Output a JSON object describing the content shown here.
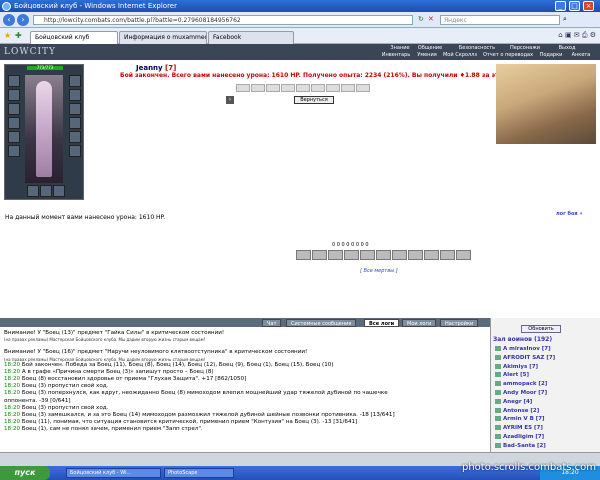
{
  "window": {
    "title": "Бойцовский клуб - Windows Internet Explorer"
  },
  "browser": {
    "address": "http://lowcity.combats.com/battle.pl?battle=0.279608184956762",
    "search_placeholder": "Яндекс",
    "tabs": [
      {
        "label": "Бойцовский клуб"
      },
      {
        "label": "Информация о muxammed"
      },
      {
        "label": "Facebook"
      }
    ]
  },
  "game_nav": {
    "logo": "LOWCITY",
    "row1": [
      "Знание",
      "Общение",
      "Безопасность",
      "Персонажи",
      "Выход"
    ],
    "row2": [
      "Инвентарь",
      "Умения",
      "Мой Скроллз",
      "Отчет о переводах",
      "Подарки",
      "Анкета"
    ]
  },
  "character": {
    "name": "Jeanny",
    "level": "[7]",
    "hp": "773/773"
  },
  "combat": {
    "result": "Бой закончен. Всего вами нанесено урона: 1610 HP. Получено опыта: 2234 (216%). Вы получили ♦1.88 за этот бой.",
    "return_label": "Вернуться",
    "counters": "0 0 0 0 0 0 0 0",
    "all_dead": "[ Все мертвы ]",
    "battle_log": "лог боя »",
    "damage_text": "На данный момент вами нанесено урона: 1610 HP."
  },
  "chat": {
    "tabs": [
      "Чат",
      "Системные сообщения",
      "Все логи",
      "Мои логи",
      "Настройки"
    ],
    "active_tab": "Все логи",
    "lines": [
      {
        "text": "Внимание! У \"Боец (13)\" предмет \"Гайка Силы\" в критическом состоянии!"
      },
      {
        "text": "(на правах рекламы) Мастерская Бойцовского клуба. Мы дадим вторую жизнь старым вещам!",
        "small": true
      },
      {
        "text": ""
      },
      {
        "text": "Внимание! У \"Боец (16)\" предмет \"Наручи неуловимого клятвоотступника\" в критическом состоянии!"
      },
      {
        "text": "(на правах рекламы) Мастерская Бойцовского клуба. Мы дадим вторую жизнь старым вещам!",
        "small": true
      },
      {
        "time": "18:20",
        "text": "Бой закончен. Победа за Боец (11), Боец (8), Боец (14), Боец (12), Боец (9), Боец (1), Боец (15), Боец (10)"
      },
      {
        "time": "18:20",
        "text": "A в графе «Причина смерти Боец (3)» запишут просто – Боец (8)"
      },
      {
        "time": "18:20",
        "text": "Боец (8) восстановил здоровье от приема \"Глухая Защита\". +17 [862/1050]"
      },
      {
        "time": "18:20",
        "text": "Боец (3) пропустил свой ход."
      },
      {
        "time": "18:20",
        "text": "Боец (3) поперхнулся, как вдруг, неожиданно Боец (8) мимоходом влепил мощнейший удар тяжелой дубиной по чашечке"
      },
      {
        "text": "оппонента. -39 [0/641]"
      },
      {
        "time": "18:20",
        "text": "Боец (3) пропустил свой ход."
      },
      {
        "time": "18:20",
        "text": "Боец (3) замешкался, и за это Боец (14) мимоходом размозжил тяжелой дубиной шейные позвонки противника. -18 [13/641]"
      },
      {
        "time": "18:20",
        "text": "Боец (11), понимая, что ситуация становится критической, применил прием \"Контузия\" на Боец (3). -13 [31/641]"
      },
      {
        "time": "18:20",
        "text": "Боец (1), сам не понял зачем, применил прием \"Залп стрел\"."
      }
    ]
  },
  "room": {
    "refresh": "Обновить",
    "title": "Зал воинов (192)",
    "players": [
      "A mirasInov [7]",
      "AFRODIT SAZ [7]",
      "Akimiys [7]",
      "Alert [5]",
      "ammopack [2]",
      "Andy Moor [7]",
      "Anegr [4]",
      "Antonse [2]",
      "Armin V B [7]",
      "AYRIM ES [7]",
      "Azadligim [7]",
      "Bad-Santa [2]"
    ]
  },
  "taskbar": {
    "start": "пуск",
    "items": [
      "Бойцовский клуб - Wi...",
      "PhotoScape"
    ],
    "clock": "18:20"
  },
  "watermark": "photo.scrolls.combats.com",
  "colors": {
    "accent": "#3a4656",
    "result": "#cc0000",
    "player": "#3333aa",
    "time": "#008800"
  }
}
